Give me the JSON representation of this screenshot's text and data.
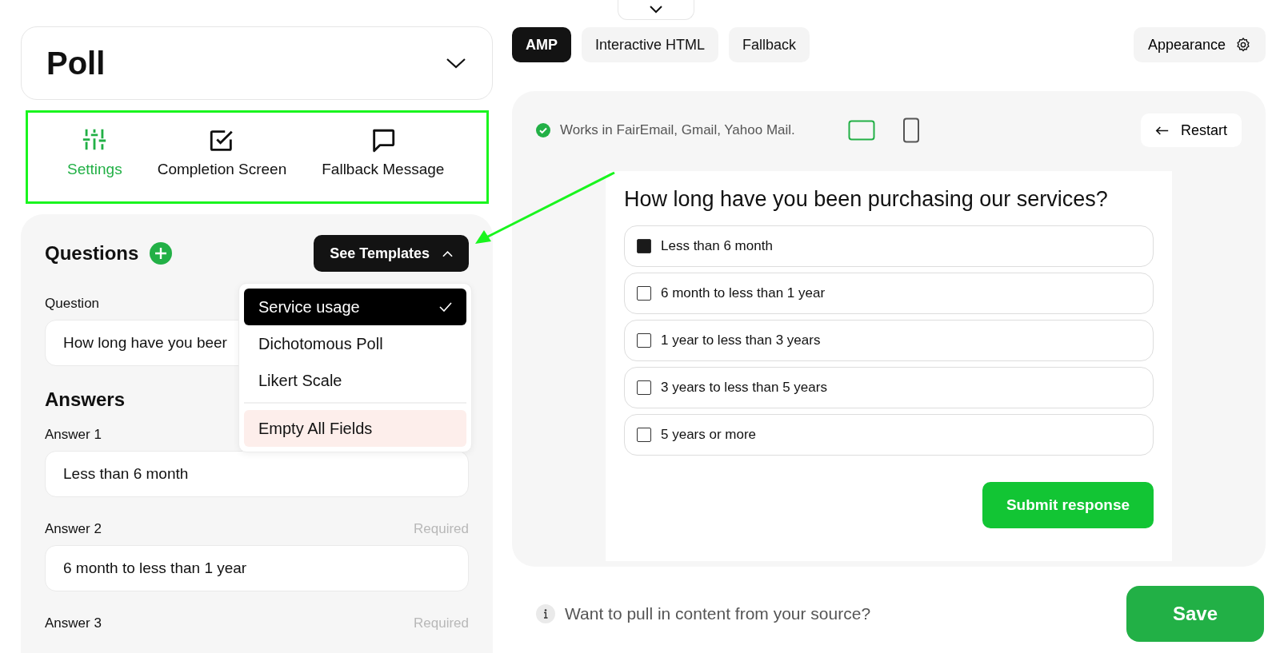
{
  "header": {
    "title": "Poll"
  },
  "section_tabs": [
    {
      "label": "Settings",
      "selected": true
    },
    {
      "label": "Completion Screen",
      "selected": false
    },
    {
      "label": "Fallback Message",
      "selected": false
    }
  ],
  "questions": {
    "title": "Questions",
    "templates_button": "See Templates",
    "templates_menu": [
      {
        "label": "Service usage",
        "selected": true,
        "kind": "template"
      },
      {
        "label": "Dichotomous Poll",
        "selected": false,
        "kind": "template"
      },
      {
        "label": "Likert Scale",
        "selected": false,
        "kind": "template"
      },
      {
        "label": "Empty All Fields",
        "selected": false,
        "kind": "danger"
      }
    ],
    "question_label": "Question",
    "question_value": "How long have you beer",
    "answers_title": "Answers",
    "answers": [
      {
        "label": "Answer 1",
        "value": "Less than 6 month"
      },
      {
        "label": "Answer 2",
        "note": "Required",
        "value": "6 month to less than 1 year"
      },
      {
        "label": "Answer 3",
        "note": "Required"
      }
    ]
  },
  "format_tabs": [
    {
      "label": "AMP",
      "selected": true
    },
    {
      "label": "Interactive HTML",
      "selected": false
    },
    {
      "label": "Fallback",
      "selected": false
    }
  ],
  "appearance_button": "Appearance",
  "preview": {
    "compat_note": "Works in FairEmail, Gmail, Yahoo Mail.",
    "devices": [
      {
        "kind": "desktop",
        "selected": true
      },
      {
        "kind": "mobile",
        "selected": false
      }
    ],
    "restart_button": "Restart",
    "question": "How long have you been purchasing our services?",
    "options": [
      {
        "label": "Less than 6 month",
        "checked": true
      },
      {
        "label": "6 month to less than 1 year",
        "checked": false
      },
      {
        "label": "1 year to less than 3 years",
        "checked": false
      },
      {
        "label": "3 years to less than 5 years",
        "checked": false
      },
      {
        "label": "5 years or more",
        "checked": false
      }
    ],
    "submit_button": "Submit response"
  },
  "footer": {
    "hint": "Want to pull in content from your source?",
    "save_button": "Save"
  }
}
